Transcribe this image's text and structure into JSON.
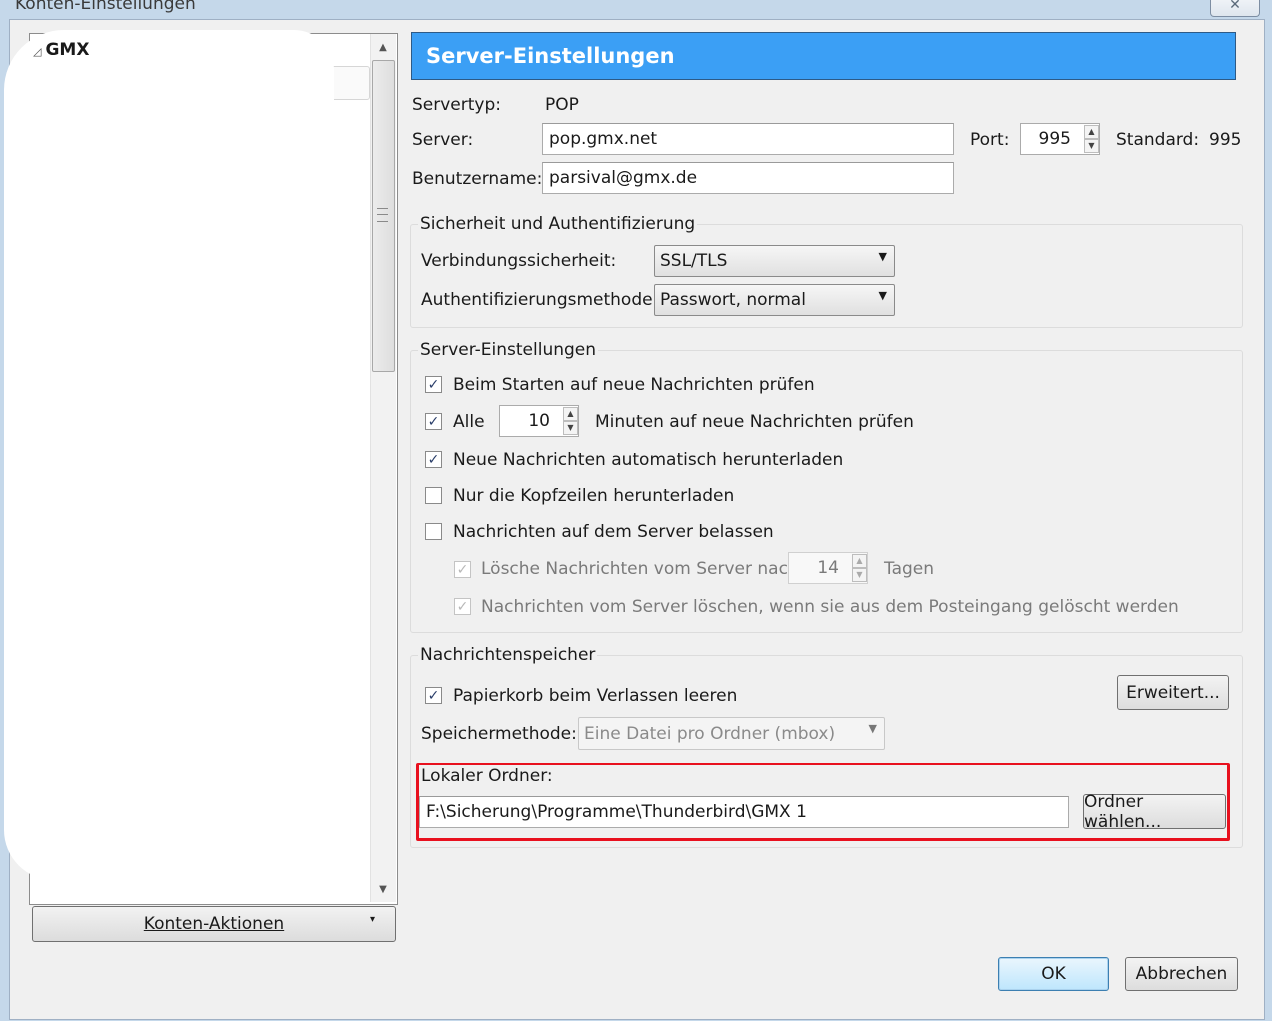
{
  "window": {
    "title": "Konten-Einstellungen",
    "close_symbol": "✕"
  },
  "tree": {
    "account": "GMX",
    "expand_symbol": "◿",
    "actions_button": "Konten-Aktionen",
    "actions_arrow": "▾"
  },
  "header": {
    "title": "Server-Einstellungen"
  },
  "server": {
    "type_label": "Servertyp:",
    "type_value": "POP",
    "server_label": "Server:",
    "server_value": "pop.gmx.net",
    "port_label": "Port:",
    "port_value": "995",
    "standard_label": "Standard:",
    "standard_value": "995",
    "user_label": "Benutzername:",
    "user_value": "parsival@gmx.de"
  },
  "security": {
    "legend": "Sicherheit und Authentifizierung",
    "conn_label": "Verbindungssicherheit:",
    "conn_value": "SSL/TLS",
    "auth_label": "Authentifizierungsmethode:",
    "auth_value": "Passwort, normal"
  },
  "server_settings": {
    "legend": "Server-Einstellungen",
    "check_on_start": {
      "label": "Beim Starten auf neue Nachrichten prüfen",
      "checked": true
    },
    "check_every": {
      "label_prefix": "Alle",
      "minutes": "10",
      "label_suffix": "Minuten auf neue Nachrichten prüfen",
      "checked": true
    },
    "auto_download": {
      "label": "Neue Nachrichten automatisch herunterladen",
      "checked": true
    },
    "headers_only": {
      "label": "Nur die Kopfzeilen herunterladen",
      "checked": false
    },
    "leave_on_server": {
      "label": "Nachrichten auf dem Server belassen",
      "checked": false
    },
    "delete_after": {
      "label": "Lösche Nachrichten vom Server nach",
      "days": "14",
      "suffix": "Tagen",
      "checked": true
    },
    "delete_when_removed": {
      "label": "Nachrichten vom Server löschen, wenn sie aus dem Posteingang gelöscht werden",
      "checked": true
    }
  },
  "storage": {
    "legend": "Nachrichtenspeicher",
    "empty_trash": {
      "label": "Papierkorb beim Verlassen leeren",
      "checked": true
    },
    "advanced_button": "Erweitert...",
    "method_label": "Speichermethode:",
    "method_value": "Eine Datei pro Ordner (mbox)",
    "local_folder_label": "Lokaler Ordner:",
    "local_folder_value": "F:\\Sicherung\\Programme\\Thunderbird\\GMX 1",
    "choose_folder_button": "Ordner wählen..."
  },
  "footer": {
    "ok": "OK",
    "cancel": "Abbrechen"
  },
  "symbols": {
    "check": "✓",
    "dropdown": "▼",
    "up": "▲",
    "down": "▼"
  },
  "colors": {
    "header_bg": "#3b9ff5",
    "highlight_border": "#e8101e"
  }
}
